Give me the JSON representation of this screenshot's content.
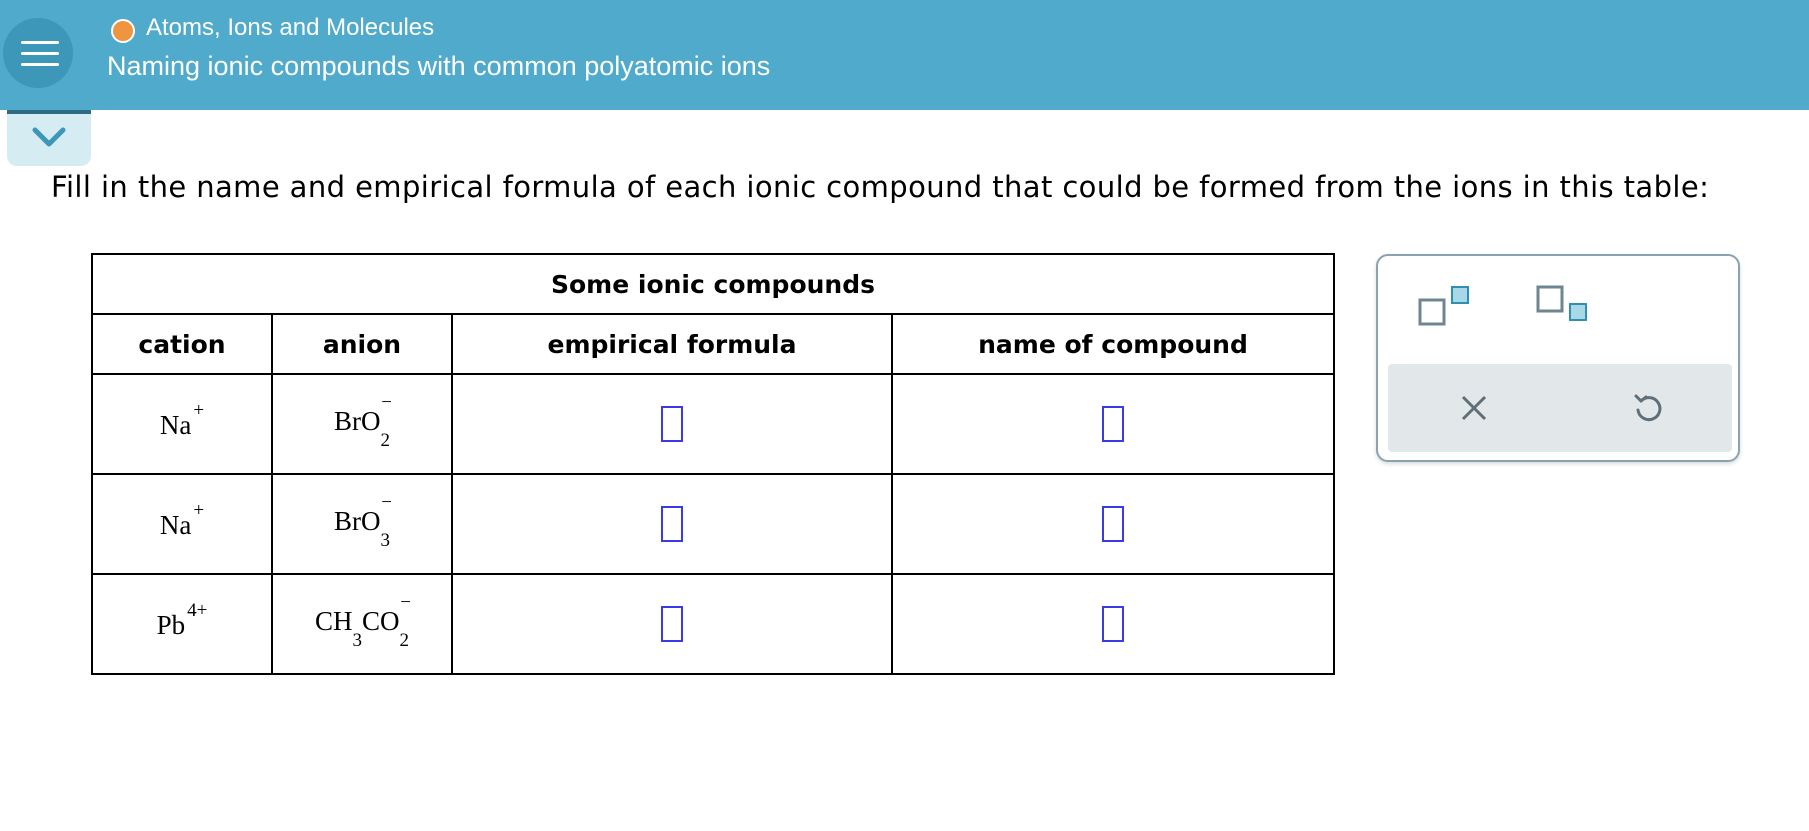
{
  "header": {
    "topic": "Atoms, Ions and Molecules",
    "title": "Naming ionic compounds with common polyatomic ions"
  },
  "prompt": "Fill in the name and empirical formula of each ionic compound that could be formed from the ions in this table:",
  "table": {
    "caption": "Some ionic compounds",
    "columns": [
      "cation",
      "anion",
      "empirical formula",
      "name of compound"
    ],
    "rows": [
      {
        "cation": {
          "symbol": "Na",
          "charge": "+"
        },
        "anion": {
          "parts": [
            "BrO",
            "2"
          ],
          "charge": "−"
        }
      },
      {
        "cation": {
          "symbol": "Na",
          "charge": "+"
        },
        "anion": {
          "parts": [
            "BrO",
            "3"
          ],
          "charge": "−"
        }
      },
      {
        "cation": {
          "symbol": "Pb",
          "charge": "4+"
        },
        "anion": {
          "parts": [
            "CH",
            "3",
            "CO",
            "2"
          ],
          "charge": "−"
        }
      }
    ]
  },
  "colors": {
    "header": "#4faacb",
    "accent_orange": "#f0953f",
    "answer_box": "#3a3ae6"
  },
  "tools": [
    "superscript-icon",
    "subscript-icon",
    "clear-icon",
    "undo-icon"
  ]
}
